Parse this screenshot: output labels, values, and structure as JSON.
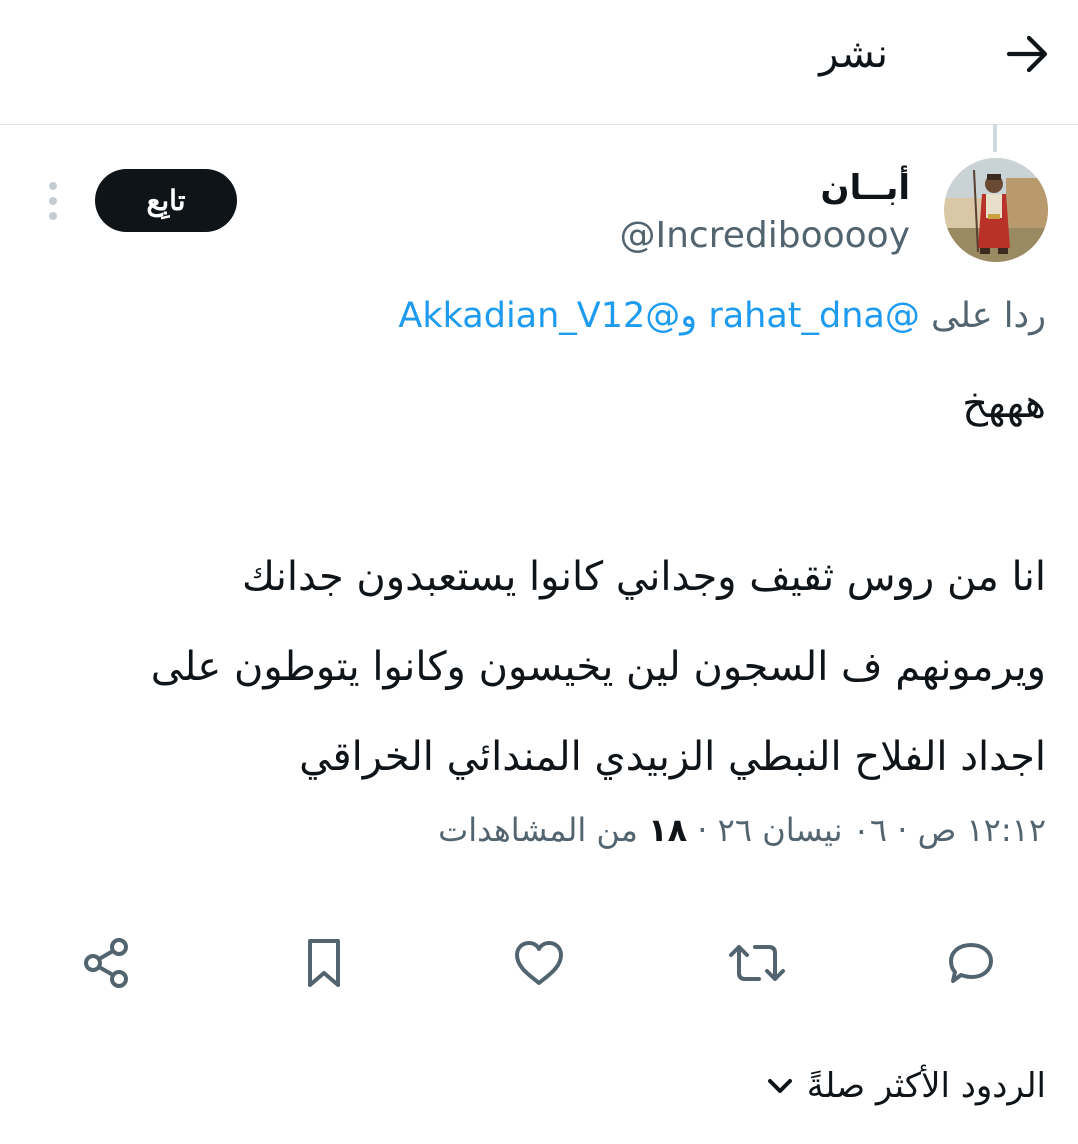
{
  "header": {
    "title": "نشر",
    "back_icon": "arrow-right-icon"
  },
  "tweet": {
    "author": {
      "display_name": "أبــان",
      "handle": "@Incredibooooy"
    },
    "follow_label": "تابِع",
    "reply_prefix": "ردا على",
    "mention_1": "@rahat_dna",
    "mention_joiner": " و",
    "mention_2": "@Akkadian_V12",
    "line_1": "هههخ",
    "paragraph": "انا من روس ثقيف وجداني كانوا يستعبدون جدانك ويرمونهم ف السجون لين يخيسون وكانوا يتوطون على اجداد الفلاح النبطي الزبيدي المندائي الخراقي",
    "meta": {
      "time": "١٢:١٢ ص",
      "separator": "·",
      "date": "٠٦ نيسان ٢٦",
      "views_count": "١٨",
      "views_label": "من المشاهدات"
    }
  },
  "actions": {
    "reply_icon": "reply-icon",
    "retweet_icon": "retweet-icon",
    "like_icon": "heart-icon",
    "bookmark_icon": "bookmark-icon",
    "share_icon": "share-icon"
  },
  "replies_sort": {
    "label": "الردود الأكثر صلةً"
  },
  "colors": {
    "text": "#0f1419",
    "secondary": "#536471",
    "link": "#1d9bf0",
    "follow_bg": "#0f1419"
  }
}
